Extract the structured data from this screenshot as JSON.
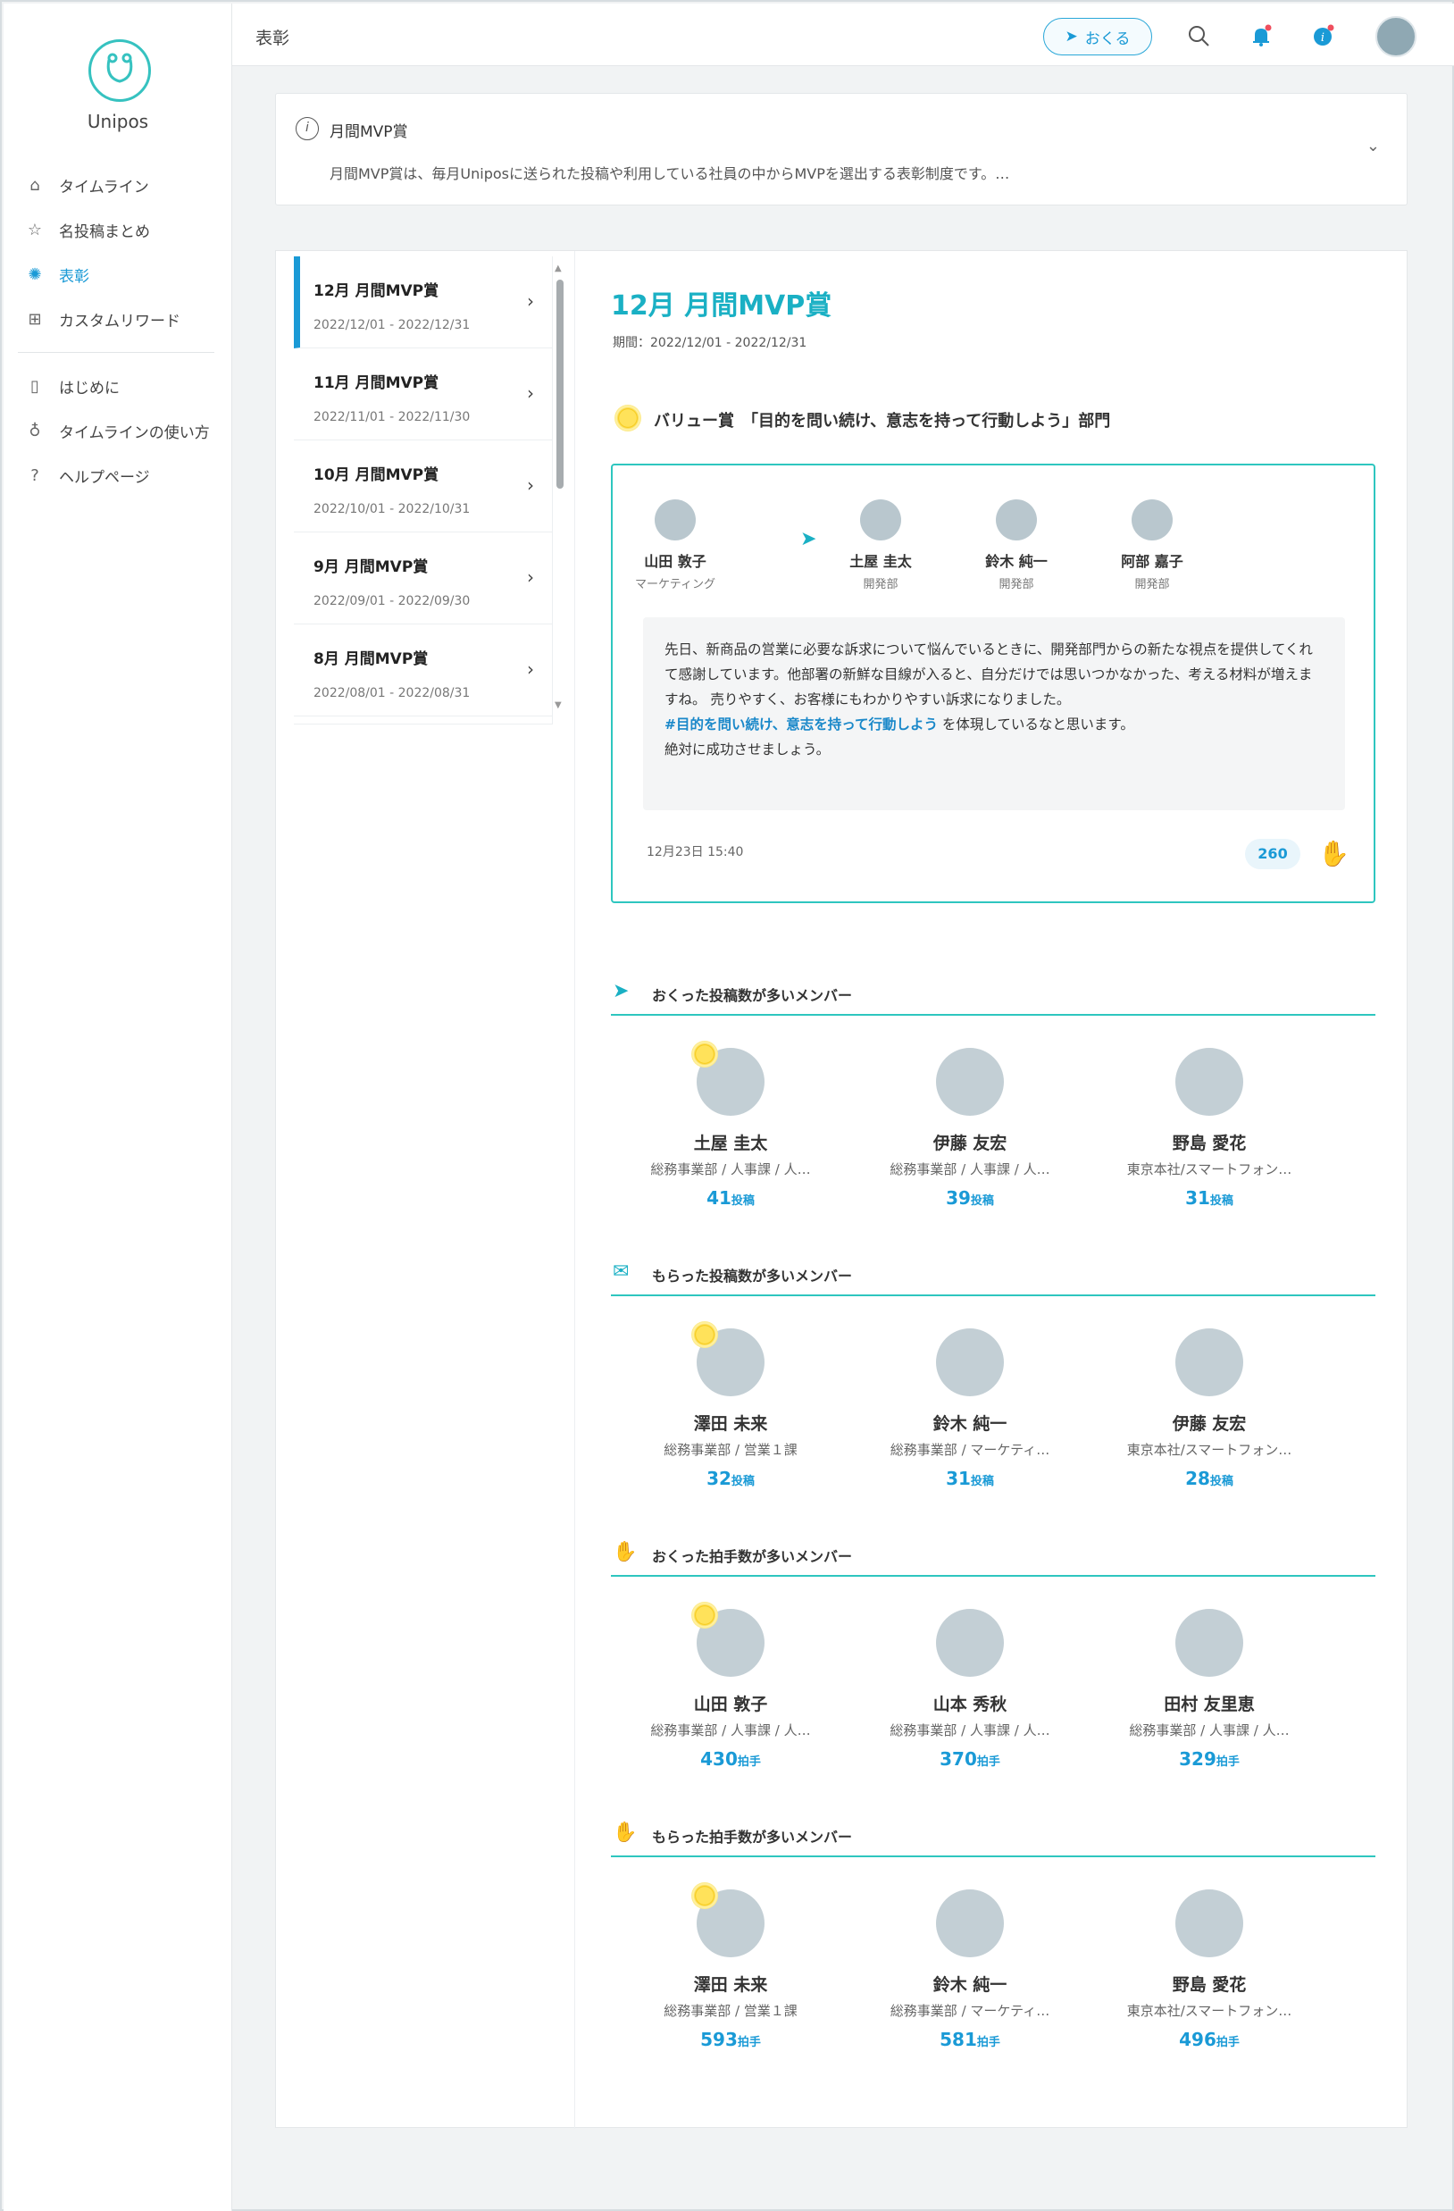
{
  "app": {
    "name": "Unipos"
  },
  "header": {
    "page_label": "表彰",
    "send_label": "おくる"
  },
  "sidebar": {
    "items": [
      {
        "label": "タイムライン",
        "icon": "home-icon"
      },
      {
        "label": "名投稿まとめ",
        "icon": "star-icon"
      },
      {
        "label": "表彰",
        "icon": "award-icon",
        "active": true
      },
      {
        "label": "カスタムリワード",
        "icon": "gift-icon"
      }
    ],
    "secondary": [
      {
        "label": "はじめに",
        "icon": "document-icon"
      },
      {
        "label": "タイムラインの使い方",
        "icon": "lightbulb-icon"
      },
      {
        "label": "ヘルプページ",
        "icon": "question-icon"
      }
    ]
  },
  "info": {
    "title": "月間MVP賞",
    "description": "月間MVP賞は、毎月Uniposに送られた投稿や利用している社員の中からMVPを選出する表彰制度です。…"
  },
  "months": [
    {
      "title": "12月 月間MVP賞",
      "period": "2022/12/01 - 2022/12/31"
    },
    {
      "title": "11月 月間MVP賞",
      "period": "2022/11/01 - 2022/11/30"
    },
    {
      "title": "10月 月間MVP賞",
      "period": "2022/10/01 - 2022/10/31"
    },
    {
      "title": "9月 月間MVP賞",
      "period": "2022/09/01 - 2022/09/30"
    },
    {
      "title": "8月 月間MVP賞",
      "period": "2022/08/01 - 2022/08/31"
    }
  ],
  "award": {
    "title": "12月 月間MVP賞",
    "period": "期間：2022/12/01 - 2022/12/31",
    "value_label": "バリュー賞　「目的を問い続け、意志を持って行動しよう」部門",
    "post": {
      "sender": {
        "name": "山田 敦子",
        "dept": "マーケティング"
      },
      "recipients": [
        {
          "name": "土屋 圭太",
          "dept": "開発部"
        },
        {
          "name": "鈴木 純一",
          "dept": "開発部"
        },
        {
          "name": "阿部 嘉子",
          "dept": "開発部"
        }
      ],
      "message_1": "先日、新商品の営業に必要な訴求について悩んでいるときに、開発部門からの新たな視点を提供してくれて感謝しています。他部署の新鮮な目線が入ると、自分だけでは思いつかなかった、考える材料が増えますね。 売りやすく、お客様にもわかりやすい訴求になりました。",
      "hashtag": "#目的を問い続け、意志を持って行動しよう",
      "message_2": " を体現しているなと思います。",
      "message_3": "絶対に成功させましょう。",
      "date": "12月23日 15:40",
      "claps": "260"
    }
  },
  "rankings": [
    {
      "title": "おくった投稿数が多いメンバー",
      "unit": "投稿",
      "members": [
        {
          "name": "土屋 圭太",
          "dept": "総務事業部 / 人事課 / 人…",
          "value": "41"
        },
        {
          "name": "伊藤 友宏",
          "dept": "総務事業部 / 人事課 / 人…",
          "value": "39"
        },
        {
          "name": "野島 愛花",
          "dept": "東京本社/スマートフォン…",
          "value": "31"
        }
      ]
    },
    {
      "title": "もらった投稿数が多いメンバー",
      "unit": "投稿",
      "members": [
        {
          "name": "澤田 未来",
          "dept": "総務事業部 / 営業１課",
          "value": "32"
        },
        {
          "name": "鈴木 純一",
          "dept": "総務事業部 / マーケティ…",
          "value": "31"
        },
        {
          "name": "伊藤 友宏",
          "dept": "東京本社/スマートフォン…",
          "value": "28"
        }
      ]
    },
    {
      "title": "おくった拍手数が多いメンバー",
      "unit": "拍手",
      "members": [
        {
          "name": "山田 敦子",
          "dept": "総務事業部 / 人事課 / 人…",
          "value": "430"
        },
        {
          "name": "山本 秀秋",
          "dept": "総務事業部 / 人事課 / 人…",
          "value": "370"
        },
        {
          "name": "田村 友里恵",
          "dept": "総務事業部 / 人事課 / 人…",
          "value": "329"
        }
      ]
    },
    {
      "title": "もらった拍手数が多いメンバー",
      "unit": "拍手",
      "members": [
        {
          "name": "澤田 未来",
          "dept": "総務事業部 / 営業１課",
          "value": "593"
        },
        {
          "name": "鈴木 純一",
          "dept": "総務事業部 / マーケティ…",
          "value": "581"
        },
        {
          "name": "野島 愛花",
          "dept": "東京本社/スマートフォン…",
          "value": "496"
        }
      ]
    }
  ],
  "colors": {
    "accent": "#1a9ad6",
    "teal": "#2ec6bf",
    "title": "#1ab0c4"
  }
}
